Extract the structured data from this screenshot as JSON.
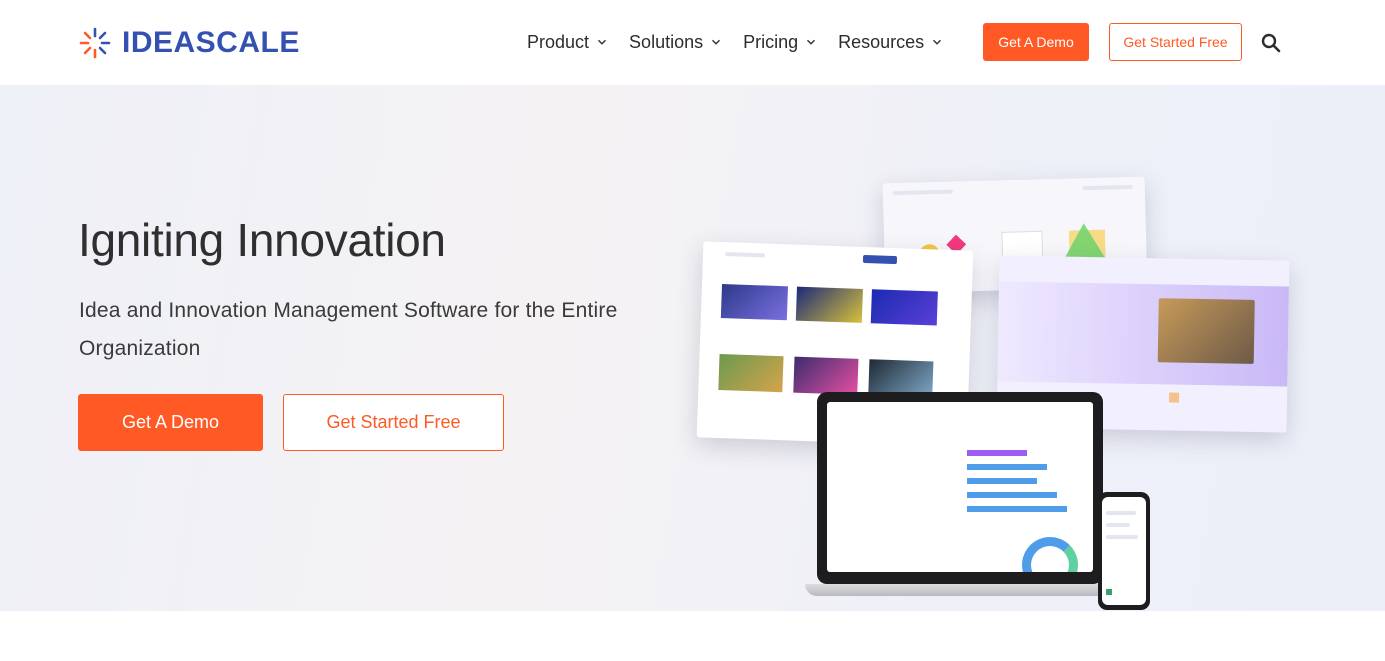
{
  "brand": {
    "name": "IDEASCALE",
    "color": "#3451b2",
    "accent": "#ff5a26"
  },
  "nav": {
    "items": [
      {
        "label": "Product"
      },
      {
        "label": "Solutions"
      },
      {
        "label": "Pricing"
      },
      {
        "label": "Resources"
      }
    ],
    "demo_label": "Get A Demo",
    "free_label": "Get Started Free",
    "search_icon": "search-icon"
  },
  "hero": {
    "title": "Igniting Innovation",
    "subtitle": "Idea and Innovation Management Software for the Entire Organization",
    "demo_label": "Get A Demo",
    "free_label": "Get Started Free"
  }
}
